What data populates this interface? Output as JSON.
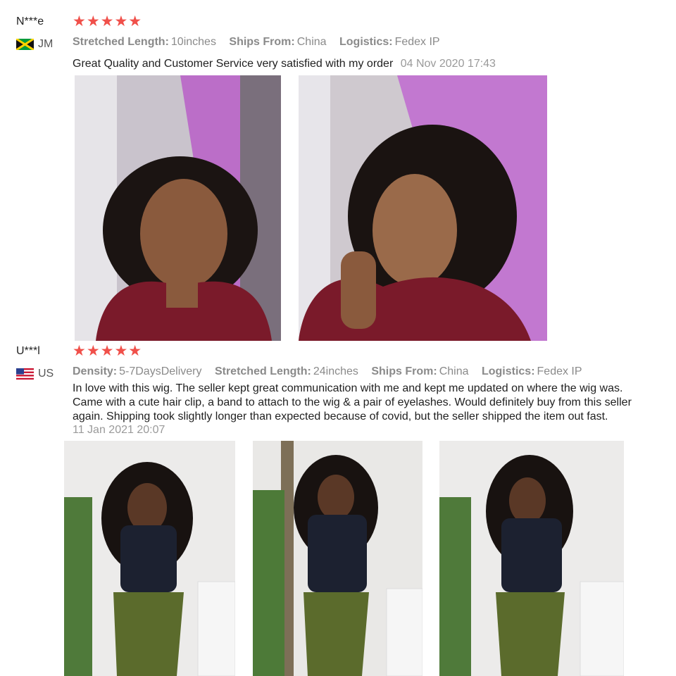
{
  "reviews": [
    {
      "user": "N***e",
      "rating": 5,
      "stars": "★★★★★",
      "country_code": "JM",
      "flag_icon": "jamaica-flag-icon",
      "attributes": [
        {
          "key": "Stretched Length:",
          "value": "10inches"
        },
        {
          "key": "Ships From:",
          "value": "China"
        },
        {
          "key": "Logistics:",
          "value": "Fedex IP"
        }
      ],
      "text": "Great Quality and Customer Service very satisfied with my order",
      "date": "04 Nov 2020 17:43",
      "photo_count": 2
    },
    {
      "user": "U***l",
      "rating": 5,
      "stars": "★★★★★",
      "country_code": "US",
      "flag_icon": "us-flag-icon",
      "attributes": [
        {
          "key": "Density:",
          "value": "5-7DaysDelivery"
        },
        {
          "key": "Stretched Length:",
          "value": "24inches"
        },
        {
          "key": "Ships From:",
          "value": "China"
        },
        {
          "key": "Logistics:",
          "value": "Fedex IP"
        }
      ],
      "text_lines": [
        "In love with this wig. The seller kept great communication with me and kept me updated on where the wig was.",
        "Came with a cute hair clip, a band to attach to the wig & a pair of eyelashes. Would definitely buy from this seller",
        "again. Shipping took slightly longer than expected because of covid, but the seller shipped the item out fast."
      ],
      "date": "11 Jan 2021 20:07",
      "photo_count": 3
    }
  ],
  "colors": {
    "star": "#f0504a",
    "meta_gray": "#8a8a8a",
    "date_gray": "#9a9a9a",
    "text": "#1f1f1f"
  }
}
